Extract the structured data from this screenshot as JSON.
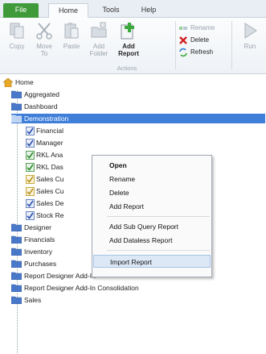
{
  "tabs": {
    "file": "File",
    "home": "Home",
    "tools": "Tools",
    "help": "Help"
  },
  "ribbon": {
    "copy": "Copy",
    "move_to": "Move\nTo",
    "paste": "Paste",
    "add_folder": "Add\nFolder",
    "add_report": "Add\nReport",
    "rename": "Rename",
    "delete": "Delete",
    "refresh": "Refresh",
    "run": "Run",
    "group_actions": "Actions"
  },
  "tree": {
    "root": "Home",
    "items": [
      "Aggregated",
      "Dashboard",
      "Demonstration",
      "Financial",
      "Manager",
      "RKL Ana",
      "RKL Das",
      "Sales Cu",
      "Sales Cu",
      "Sales De",
      "Stock Re",
      "Designer",
      "Financials",
      "Inventory",
      "Purchases",
      "Report Designer Add-In",
      "Report Designer Add-In Consolidation",
      "Sales"
    ]
  },
  "context_menu": {
    "items": [
      "Open",
      "Rename",
      "Delete",
      "Add Report",
      "Add Sub Query Report",
      "Add Dataless Report",
      "Import Report"
    ]
  },
  "colors": {
    "file_tab": "#3f9b3a",
    "selection": "#3f7fd9",
    "folder": "#4a78c8",
    "menu_hover": "#dde8f6"
  }
}
